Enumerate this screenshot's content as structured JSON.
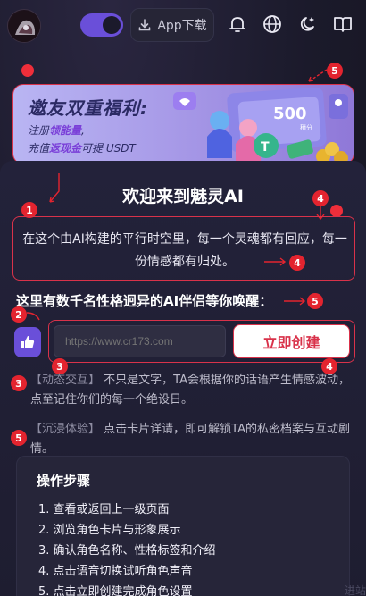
{
  "header": {
    "app_download_label": "App下载"
  },
  "banner": {
    "title": "邀友双重福利:",
    "line1_prefix": "注册",
    "line1_highlight": "领能量",
    "line1_suffix": ",",
    "line2_prefix": "充值",
    "line2_highlight": "返现金",
    "line2_suffix": "可提 USDT",
    "card_value": "500",
    "card_unit": "積分"
  },
  "main": {
    "welcome_title": "欢迎来到魅灵AI",
    "intro_text": "在这个由AI构建的平行时空里，每一个灵魂都有回应，每一份情感都有归处。",
    "subheading": "这里有数千名性格迥异的AI伴侣等你唤醒：",
    "url_placeholder": "https://www.cr173.com",
    "create_button_label": "立即创建",
    "para1_tag": "【动态交互】",
    "para1_text": "不只是文字，TA会根据你的话语产生情感波动，点至记住你们的每一个绝设日。",
    "para2_tag": "【沉浸体验】",
    "para2_text": "点击卡片详请，即可解锁TA的私密档案与互动剧情。"
  },
  "steps": {
    "title": "操作步骤",
    "items": [
      "1. 查看或返回上一级页面",
      "2. 浏览角色卡片与形象展示",
      "3. 确认角色名称、性格标签和介绍",
      "4. 点击语音切换试听角色声音",
      "5. 点击立即创建完成角色设置"
    ]
  },
  "footer": {
    "ghost_text": "进站"
  },
  "markers": [
    "1",
    "2",
    "3",
    "4",
    "5"
  ],
  "colors": {
    "accent": "#6a4fd9",
    "marker_red": "#e3242f",
    "background": "#1b1a2b"
  }
}
